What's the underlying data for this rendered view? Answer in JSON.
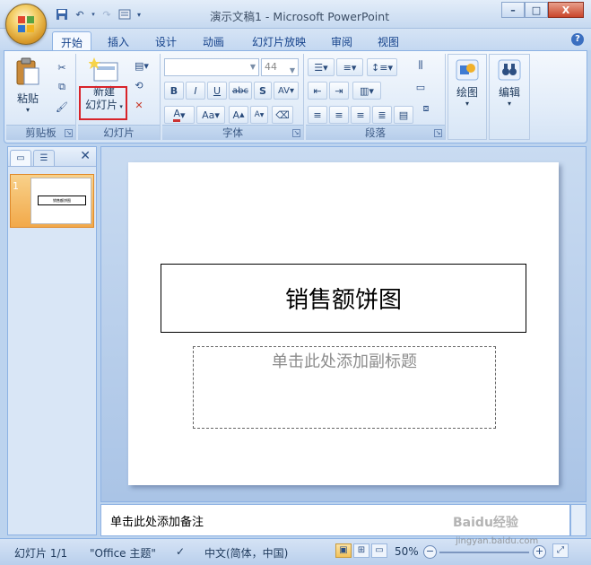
{
  "window": {
    "title": "演示文稿1 - Microsoft PowerPoint",
    "min_label": "–",
    "max_label": "□",
    "close_label": "X"
  },
  "tabs": [
    "开始",
    "插入",
    "设计",
    "动画",
    "幻灯片放映",
    "审阅",
    "视图"
  ],
  "ribbon": {
    "clipboard": {
      "group_label": "剪贴板",
      "paste_label": "粘贴"
    },
    "slides": {
      "group_label": "幻灯片",
      "new_slide_line1": "新建",
      "new_slide_line2": "幻灯片"
    },
    "font": {
      "group_label": "字体",
      "font_name": "",
      "font_size": "44"
    },
    "paragraph": {
      "group_label": "段落"
    },
    "drawing": {
      "draw_label": "绘图",
      "edit_label": "编辑"
    }
  },
  "left_panel": {
    "slide_number": "1",
    "thumb_title": "销售额饼图"
  },
  "slide": {
    "title": "销售额饼图",
    "subtitle_placeholder": "单击此处添加副标题"
  },
  "notes": {
    "placeholder": "单击此处添加备注"
  },
  "status": {
    "slide_count": "幻灯片 1/1",
    "theme": "\"Office 主题\"",
    "language": "中文(简体，中国)",
    "zoom": "50%"
  },
  "watermark": {
    "line1": "Baidu经验",
    "line2": "jingyan.baidu.com"
  }
}
